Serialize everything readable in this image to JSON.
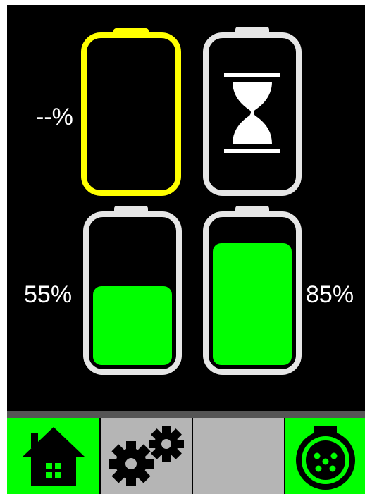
{
  "batteries": [
    {
      "id": "top-left",
      "label": "--%",
      "state": "empty",
      "outline": "#ffff00",
      "fill_level": 0
    },
    {
      "id": "top-right",
      "label": "",
      "state": "pending",
      "outline": "#ffffff",
      "icon": "hourglass-icon",
      "fill_level": 0
    },
    {
      "id": "bottom-left",
      "label": "55%",
      "state": "charged",
      "outline": "#ffffff",
      "fill_level": 0.55
    },
    {
      "id": "bottom-right",
      "label": "85%",
      "state": "charged",
      "outline": "#ffffff",
      "fill_level": 0.85
    }
  ],
  "colors": {
    "background": "#000000",
    "fill": "#00ff00",
    "active_tab": "#00ff00",
    "inactive_tab": "#b5b5b5",
    "separator": "#555555"
  },
  "nav": {
    "tabs": [
      {
        "name": "home",
        "icon": "home-icon",
        "active": true
      },
      {
        "name": "settings",
        "icon": "gears-icon",
        "active": false
      },
      {
        "name": "empty",
        "icon": "",
        "active": false
      },
      {
        "name": "connector",
        "icon": "connector-icon",
        "active": true
      }
    ]
  }
}
